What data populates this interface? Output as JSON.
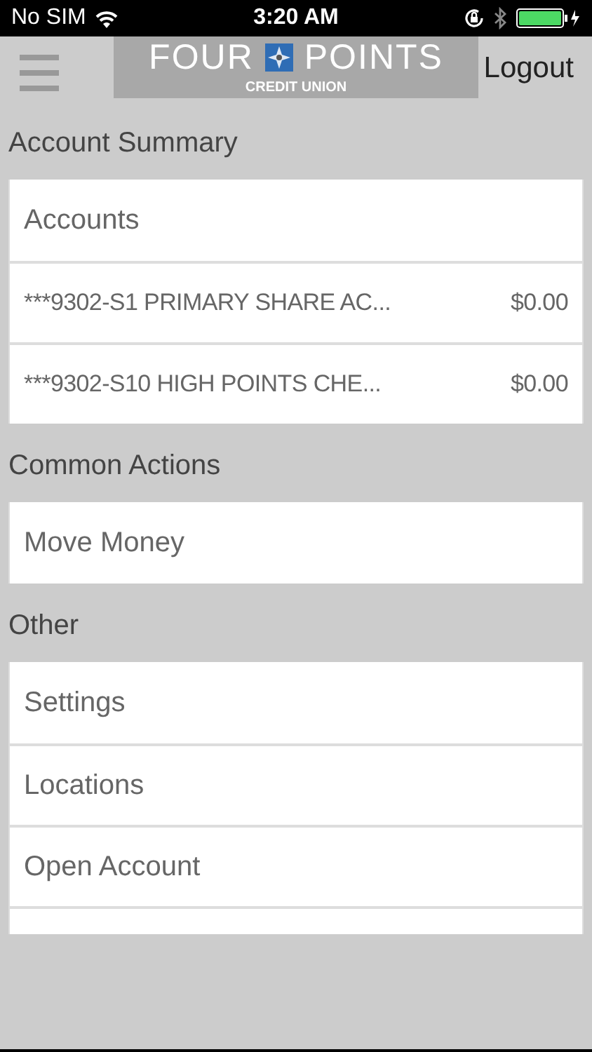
{
  "status_bar": {
    "carrier": "No SIM",
    "time": "3:20 AM"
  },
  "header": {
    "logo": {
      "word_1": "FOUR",
      "word_2": "POINTS",
      "subtitle": "CREDIT UNION"
    },
    "logout": "Logout"
  },
  "sections": [
    {
      "title": "Account Summary",
      "items": [
        {
          "kind": "link",
          "label": "Accounts"
        },
        {
          "kind": "account",
          "label": "***9302-S1 PRIMARY SHARE AC...",
          "balance": "$0.00"
        },
        {
          "kind": "account",
          "label": "***9302-S10 HIGH POINTS CHE...",
          "balance": "$0.00"
        }
      ]
    },
    {
      "title": "Common Actions",
      "items": [
        {
          "kind": "link",
          "label": "Move Money"
        }
      ]
    },
    {
      "title": "Other",
      "items": [
        {
          "kind": "link",
          "label": "Settings"
        },
        {
          "kind": "link",
          "label": "Locations"
        },
        {
          "kind": "link",
          "label": "Open Account"
        },
        {
          "kind": "partial"
        }
      ]
    }
  ]
}
